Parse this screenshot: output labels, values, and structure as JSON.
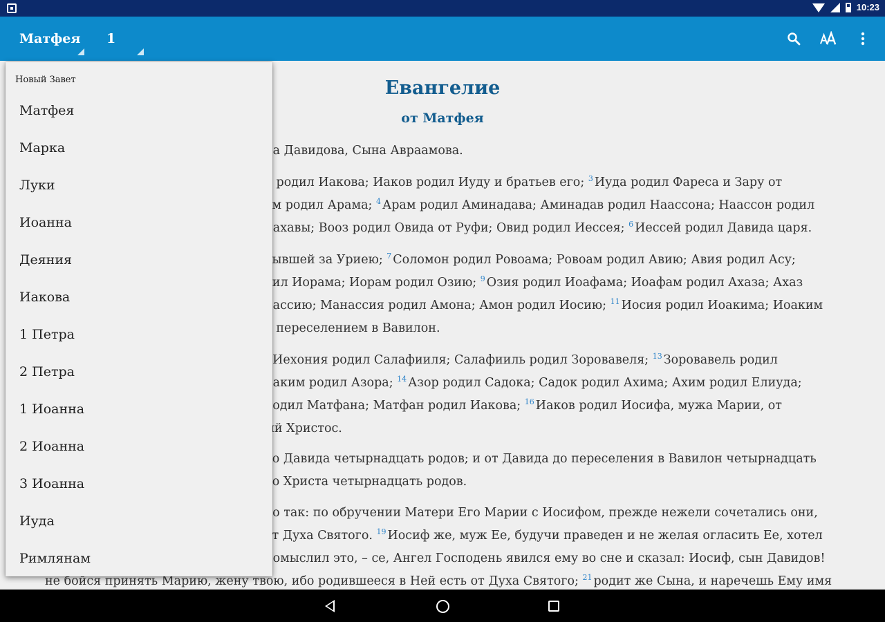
{
  "status_bar": {
    "time": "10:23"
  },
  "app_bar": {
    "book": "Матфея",
    "chapter": "1",
    "actions": [
      "search-icon",
      "text-size-icon",
      "overflow-menu-icon"
    ]
  },
  "content": {
    "title": "Евангелие",
    "subtitle": "от Матфея",
    "paragraphs": [
      {
        "lines": [
          {
            "text": "на Давидова, Сына Авраамова."
          }
        ]
      },
      {
        "lines": [
          {
            "text": "к родил Иакова; Иаков родил Иуду и братьев его; ",
            "v": "3",
            "rest": "Иуда родил Фареса и Зару от"
          },
          {
            "text": "ом родил Арама; ",
            "v": "4",
            "rest": "Арам родил Аминадава; Аминадав родил Наассона; Наассон родил"
          },
          {
            "text": "Рахавы; Вооз родил Овида от Руфи; Овид родил Иессея; ",
            "v": "6",
            "rest": "Иессей родил Давида царя."
          }
        ]
      },
      {
        "lines": [
          {
            "text": "бывшей за Уриею; ",
            "v": "7",
            "rest": "Соломон родил Ровоама; Ровоам родил Авию; Авия родил Асу;"
          },
          {
            "text": "дил Иорама; Иорам родил Озию; ",
            "v": "9",
            "rest": "Озия родил Иоафама; Иоафам родил Ахаза; Ахаз"
          },
          {
            "text": "нассию; Манассия родил Амона; Амон родил Иосию; ",
            "v": "11",
            "rest": "Иосия родил Иоакима; Иоаким"
          },
          {
            "text": "д переселением в Вавилон."
          }
        ]
      },
      {
        "lines": [
          {
            "text": ", Иехония родил Салафииля; Салафииль родил Зоровавеля; ",
            "v": "13",
            "rest": "Зоровавель родил"
          },
          {
            "text": "иаким родил Азора; ",
            "v": "14",
            "rest": "Азор родил Садока; Садок родил Ахима; Ахим родил Елиуда;"
          },
          {
            "text": "родил Матфана; Матфан родил Иакова; ",
            "v": "16",
            "rest": "Иаков родил Иосифа, мужа Марии, от"
          },
          {
            "text": "ый Христос."
          }
        ]
      },
      {
        "lines": [
          {
            "text": "до Давида четырнадцать родов; и от Давида до переселения в Вавилон четырнадцать"
          },
          {
            "text": "до Христа четырнадцать родов."
          }
        ]
      },
      {
        "lines": [
          {
            "text": "ло так: по обручении Матери Его Марии с Иосифом, прежде нежели сочетались они,"
          },
          {
            "text": "от Духа Святого. ",
            "v": "19",
            "rest": "Иосиф же, муж Ее, будучи праведен и не желая огласить Ее, хотел"
          },
          {
            "text": "помыслил это, – се, Ангел Господень явился ему во сне и сказал: Иосиф, сын Давидов!"
          },
          {
            "text": "не бойся принять Марию, жену твою, ибо родившееся в Ней есть от Духа Святого; ",
            "v": "21",
            "rest": "родит же Сына, и наречешь Ему имя"
          }
        ]
      }
    ]
  },
  "dropdown": {
    "header": "Новый Завет",
    "items": [
      "Матфея",
      "Марка",
      "Луки",
      "Иоанна",
      "Деяния",
      "Иакова",
      "1 Петра",
      "2 Петра",
      "1 Иоанна",
      "2 Иоанна",
      "3 Иоанна",
      "Иуда",
      "Римлянам"
    ]
  },
  "colors": {
    "app_bar": "#0d8acb",
    "status_bar": "#0c2a6b",
    "title": "#135d8f",
    "verse_number": "#2e84c9"
  }
}
